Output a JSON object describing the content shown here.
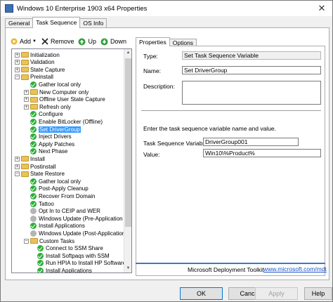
{
  "window": {
    "title": "Windows 10 Enterprise 1903 x64 Properties"
  },
  "tabs": [
    "General",
    "Task Sequence",
    "OS Info"
  ],
  "toolbar": {
    "add": "Add",
    "remove": "Remove",
    "up": "Up",
    "down": "Down"
  },
  "tree": [
    {
      "label": "Initialization",
      "icon": "folder",
      "expander": "+",
      "level": 1
    },
    {
      "label": "Validation",
      "icon": "folder",
      "expander": "+",
      "level": 1
    },
    {
      "label": "State Capture",
      "icon": "folder",
      "expander": "+",
      "level": 1
    },
    {
      "label": "Preinstall",
      "icon": "folder",
      "expander": "-",
      "level": 1
    },
    {
      "label": "Gather local only",
      "icon": "check",
      "level": 2
    },
    {
      "label": "New Computer only",
      "icon": "folder",
      "expander": "+",
      "level": 2
    },
    {
      "label": "Offline User State Capture",
      "icon": "folder",
      "expander": "+",
      "level": 2
    },
    {
      "label": "Refresh only",
      "icon": "folder",
      "expander": "+",
      "level": 2
    },
    {
      "label": "Configure",
      "icon": "check",
      "level": 2
    },
    {
      "label": "Enable BitLocker (Offline)",
      "icon": "check",
      "level": 2
    },
    {
      "label": "Set DriverGroup",
      "icon": "check",
      "level": 2,
      "selected": true
    },
    {
      "label": "Inject Drivers",
      "icon": "check",
      "level": 2
    },
    {
      "label": "Apply Patches",
      "icon": "check",
      "level": 2
    },
    {
      "label": "Next Phase",
      "icon": "check",
      "level": 2
    },
    {
      "label": "Install",
      "icon": "folder",
      "expander": "+",
      "level": 1
    },
    {
      "label": "Postinstall",
      "icon": "folder",
      "expander": "+",
      "level": 1
    },
    {
      "label": "State Restore",
      "icon": "folder",
      "expander": "-",
      "level": 1
    },
    {
      "label": "Gather local only",
      "icon": "check",
      "level": 2
    },
    {
      "label": "Post-Apply Cleanup",
      "icon": "check",
      "level": 2
    },
    {
      "label": "Recover From Domain",
      "icon": "check",
      "level": 2
    },
    {
      "label": "Tattoo",
      "icon": "check",
      "level": 2
    },
    {
      "label": "Opt In to CEIP and WER",
      "icon": "gray",
      "level": 2
    },
    {
      "label": "Windows Update (Pre-Application Inst",
      "icon": "gray",
      "level": 2
    },
    {
      "label": "Install Applications",
      "icon": "check",
      "level": 2
    },
    {
      "label": "Windows Update (Post-Application Ins",
      "icon": "gray",
      "level": 2
    },
    {
      "label": "Custom Tasks",
      "icon": "folder",
      "expander": "-",
      "level": 2
    },
    {
      "label": "Connect to SSM Share",
      "icon": "check",
      "level": 3
    },
    {
      "label": "Install Softpaqs with SSM",
      "icon": "check",
      "level": 3
    },
    {
      "label": "Run HPIA to Install HP Software",
      "icon": "check",
      "level": 3
    },
    {
      "label": "Install Applications",
      "icon": "check",
      "level": 3
    }
  ],
  "right_tabs": [
    "Properties",
    "Options"
  ],
  "properties": {
    "type_label": "Type:",
    "type_value": "Set Task Sequence Variable",
    "name_label": "Name:",
    "name_value": "Set DriverGroup",
    "description_label": "Description:",
    "description_value": "",
    "instruction": "Enter the task sequence variable name and value.",
    "variable_label": "Task Sequence Variable:",
    "variable_value": "DriverGroup001",
    "value_label": "Value:",
    "value_value": "Win10\\%Product%"
  },
  "footer": {
    "text": "Microsoft Deployment Toolkit",
    "link": "www.microsoft.com/mdt"
  },
  "buttons": {
    "ok": "OK",
    "cancel": "Cancel",
    "apply": "Apply",
    "help": "Help"
  }
}
